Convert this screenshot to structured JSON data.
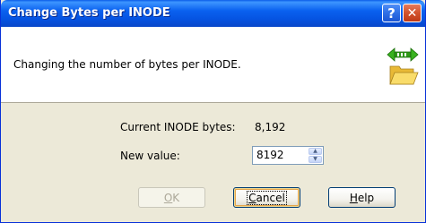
{
  "window": {
    "title": "Change Bytes per INODE",
    "help_glyph": "?",
    "close_glyph": "✕"
  },
  "header": {
    "description": "Changing the number of bytes per INODE.",
    "icon": "folder-with-green-arrows-icon"
  },
  "form": {
    "current_label": "Current INODE bytes:",
    "current_value": "8,192",
    "new_value_label": "New value:",
    "new_value": "8192"
  },
  "buttons": {
    "ok": {
      "first": "O",
      "rest": "K"
    },
    "cancel": {
      "first": "C",
      "rest": "ancel"
    },
    "help": {
      "first": "H",
      "rest": "elp"
    }
  },
  "colors": {
    "titlebar": "#0a61ef",
    "dialog_bg": "#ece9d8",
    "close_button": "#d2522d",
    "default_button_highlight": "#e5a64b"
  }
}
